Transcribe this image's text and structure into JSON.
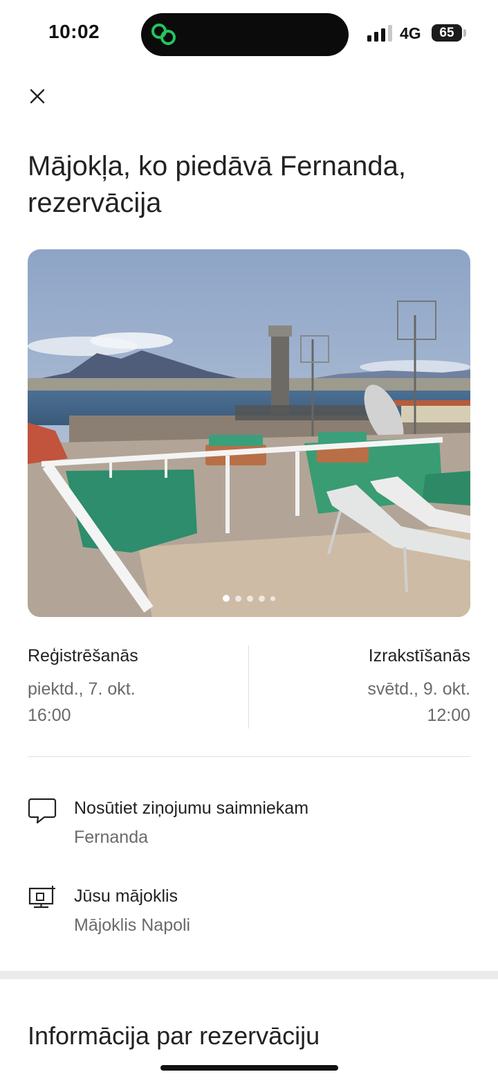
{
  "status_bar": {
    "time": "10:02",
    "network": "4G",
    "battery": "65",
    "island_icon": "green-chain-link-icon",
    "accent": "#22c55e"
  },
  "header": {
    "close_icon": "close-icon",
    "title": "Mājokļa, ko piedāvā Fernanda, rezervācija"
  },
  "photo": {
    "description_icon": "listing-photo",
    "carousel_pages": 5,
    "active_page": 1
  },
  "stay": {
    "checkin_label": "Reģistrēšanās",
    "checkin_date": "piektd., 7. okt.",
    "checkin_time": "16:00",
    "checkout_label": "Izrakstīšanās",
    "checkout_date": "svētd., 9. okt.",
    "checkout_time": "12:00"
  },
  "actions": [
    {
      "icon": "chat-bubble-icon",
      "title": "Nosūtiet ziņojumu saimniekam",
      "subtitle": "Fernanda"
    },
    {
      "icon": "home-presentation-icon",
      "title": "Jūsu mājoklis",
      "subtitle": "Mājoklis Napoli"
    }
  ],
  "section": {
    "title": "Informācija par rezervāciju"
  }
}
